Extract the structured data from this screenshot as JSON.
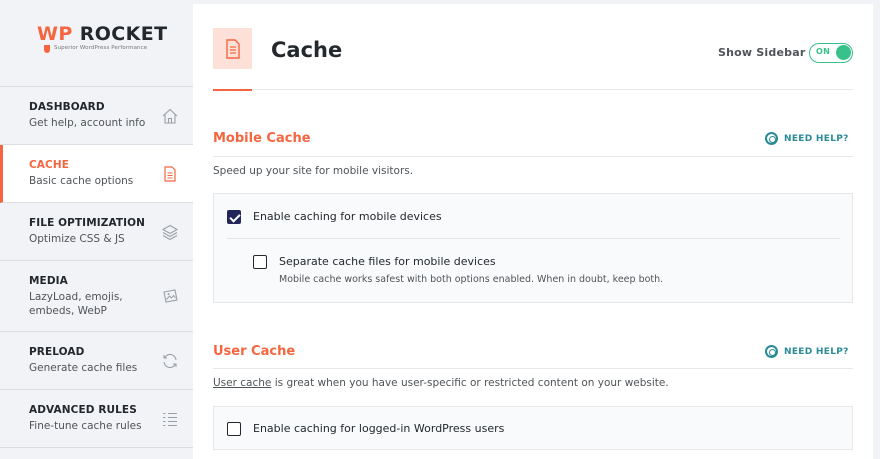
{
  "brand": {
    "wp": "WP",
    "rocket": "ROCKET",
    "tagline": "Superior WordPress Performance",
    "accent_color": "#f56640"
  },
  "nav": {
    "items": [
      {
        "title": "DASHBOARD",
        "sub": "Get help, account info",
        "icon": "home-icon"
      },
      {
        "title": "CACHE",
        "sub": "Basic cache options",
        "icon": "cache-file-icon",
        "active": true
      },
      {
        "title": "FILE OPTIMIZATION",
        "sub": "Optimize CSS & JS",
        "icon": "layers-icon"
      },
      {
        "title": "MEDIA",
        "sub": "LazyLoad, emojis, embeds, WebP",
        "icon": "images-icon"
      },
      {
        "title": "PRELOAD",
        "sub": "Generate cache files",
        "icon": "refresh-icon"
      },
      {
        "title": "ADVANCED RULES",
        "sub": "Fine-tune cache rules",
        "icon": "list-icon"
      }
    ]
  },
  "header": {
    "title": "Cache",
    "show_sidebar_label": "Show Sidebar",
    "toggle_state": "ON"
  },
  "mobile_cache": {
    "title": "Mobile Cache",
    "help": "NEED HELP?",
    "description": "Speed up your site for mobile visitors.",
    "options": [
      {
        "label": "Enable caching for mobile devices",
        "checked": true
      },
      {
        "label": "Separate cache files for mobile devices",
        "checked": false,
        "sub_link": "Mobile cache",
        "sub_text": " works safest with both options enabled. When in doubt, keep both."
      }
    ]
  },
  "user_cache": {
    "title": "User Cache",
    "help": "NEED HELP?",
    "description_link": "User cache",
    "description_text": " is great when you have user-specific or restricted content on your website.",
    "options": [
      {
        "label": "Enable caching for logged-in WordPress users",
        "checked": false
      }
    ]
  }
}
